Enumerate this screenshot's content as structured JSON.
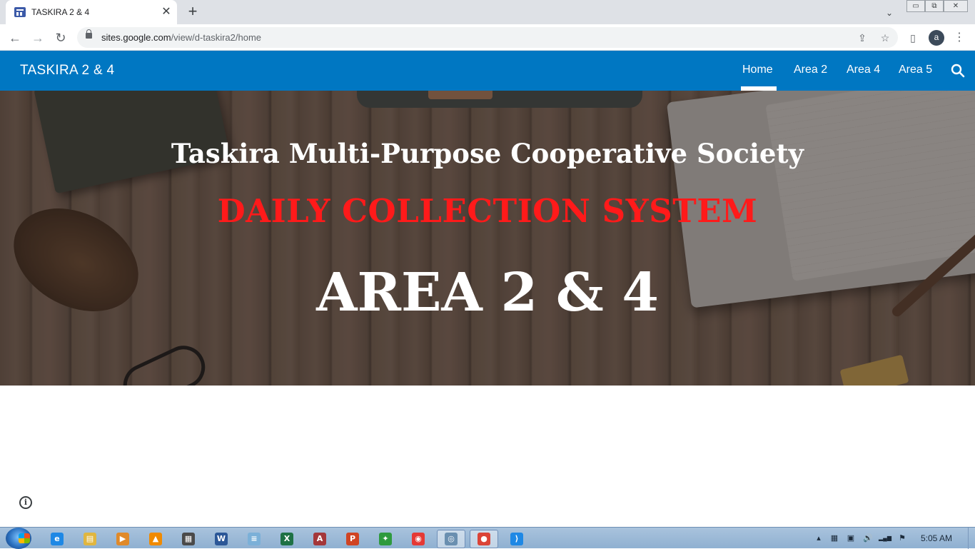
{
  "browser": {
    "tab": {
      "title": "TASKIRA 2 & 4",
      "close": "✕"
    },
    "new_tab": "+",
    "tab_search": "⌄",
    "window_controls": {
      "minimize": "▭",
      "restore": "⧉",
      "close": "✕"
    },
    "nav": {
      "back": "←",
      "forward": "→",
      "reload": "↻"
    },
    "address": {
      "host": "sites.google.com",
      "path": "/view/d-taskira2/home"
    },
    "share_icon": "⇪",
    "bookmark_icon": "☆",
    "side_panel_icon": "▯",
    "profile_initial": "a",
    "menu_icon": "⋮"
  },
  "site": {
    "title": "TASKIRA 2 & 4",
    "nav": [
      {
        "label": "Home",
        "active": true
      },
      {
        "label": "Area 2",
        "active": false
      },
      {
        "label": "Area 4",
        "active": false
      },
      {
        "label": "Area 5",
        "active": false
      }
    ]
  },
  "hero": {
    "organization": "Taskira Multi-Purpose Cooperative Society",
    "system": "DAILY COLLECTION SYSTEM",
    "area": "AREA 2 & 4",
    "system_color": "#ff1a1a"
  },
  "page": {
    "info_icon": "i"
  },
  "taskbar": {
    "apps": [
      {
        "name": "internet-explorer",
        "glyph": "e",
        "color": "#1e88e5",
        "active": false
      },
      {
        "name": "file-explorer",
        "glyph": "▤",
        "color": "#e0b640",
        "active": false
      },
      {
        "name": "media-player",
        "glyph": "▶",
        "color": "#e08a2a",
        "active": false
      },
      {
        "name": "vlc",
        "glyph": "▲",
        "color": "#f08a00",
        "active": false
      },
      {
        "name": "film-app",
        "glyph": "▦",
        "color": "#4a4a4a",
        "active": false
      },
      {
        "name": "word",
        "glyph": "W",
        "color": "#2b5797",
        "active": false
      },
      {
        "name": "notepad",
        "glyph": "≡",
        "color": "#7bb0d8",
        "active": false
      },
      {
        "name": "excel",
        "glyph": "X",
        "color": "#1e7145",
        "active": false
      },
      {
        "name": "access",
        "glyph": "A",
        "color": "#a4373a",
        "active": false
      },
      {
        "name": "powerpoint",
        "glyph": "P",
        "color": "#d04423",
        "active": false
      },
      {
        "name": "cleanup-tool",
        "glyph": "✦",
        "color": "#2e9a3e",
        "active": false
      },
      {
        "name": "anydesk",
        "glyph": "◉",
        "color": "#e53935",
        "active": false
      },
      {
        "name": "network-app",
        "glyph": "◎",
        "color": "#6a8fb0",
        "active": true
      },
      {
        "name": "chrome",
        "glyph": "●",
        "color": "#db4437",
        "active": true
      },
      {
        "name": "vscode",
        "glyph": "⟩",
        "color": "#1e88e5",
        "active": false
      }
    ],
    "tray": {
      "show_hidden": "▴",
      "keyboard": "▦",
      "security": "▣",
      "volume": "🔊",
      "network": "▂▄▆",
      "flag": "⚑"
    },
    "clock": "5:05 AM"
  }
}
